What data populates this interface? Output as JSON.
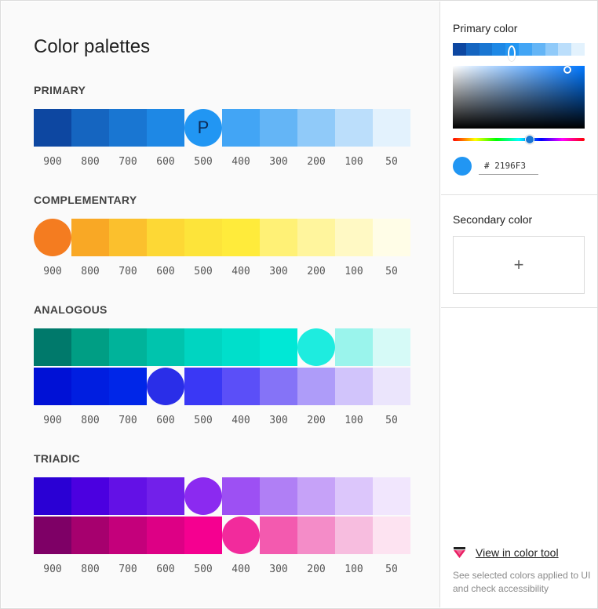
{
  "title": "Color palettes",
  "weights": [
    "900",
    "800",
    "700",
    "600",
    "500",
    "400",
    "300",
    "200",
    "100",
    "50"
  ],
  "sections": {
    "primary": {
      "label": "PRIMARY",
      "rows": [
        {
          "colors": [
            "#0d47a1",
            "#1565c0",
            "#1976d2",
            "#1e88e5",
            "#2196f3",
            "#42a5f5",
            "#64b5f6",
            "#90caf9",
            "#bbdefb",
            "#e3f2fd"
          ],
          "selected": 4,
          "mark": "P"
        }
      ]
    },
    "complementary": {
      "label": "COMPLEMENTARY",
      "rows": [
        {
          "colors": [
            "#f47c20",
            "#f9a825",
            "#fbc02d",
            "#fdd835",
            "#fde43a",
            "#ffeb3b",
            "#fff176",
            "#fff59d",
            "#fff9c4",
            "#fffde7"
          ],
          "selected": 0,
          "mark": ""
        }
      ]
    },
    "analogous": {
      "label": "ANALOGOUS",
      "rows": [
        {
          "colors": [
            "#00796b",
            "#009e84",
            "#00b39a",
            "#00c4ad",
            "#00d5c1",
            "#00dfcb",
            "#00e8d6",
            "#1eecdf",
            "#9af4ec",
            "#d6faf7"
          ],
          "selected": 7,
          "mark": ""
        },
        {
          "colors": [
            "#0011d6",
            "#001ee0",
            "#0026e8",
            "#2a2ee8",
            "#3a38f5",
            "#5b4ff8",
            "#8573f7",
            "#ae9cf9",
            "#d1c4fb",
            "#ebe5fc"
          ],
          "selected": 3,
          "mark": ""
        }
      ]
    },
    "triadic": {
      "label": "TRIADIC",
      "rows": [
        {
          "colors": [
            "#2a00d4",
            "#4b00e0",
            "#6311e6",
            "#7220ea",
            "#8b2af0",
            "#9d50f3",
            "#b07ff5",
            "#c6a2f8",
            "#dcc6fb",
            "#f1e6fd"
          ],
          "selected": 4,
          "mark": ""
        },
        {
          "colors": [
            "#7e0066",
            "#a6006e",
            "#c4007b",
            "#dd0085",
            "#f50090",
            "#f22b9c",
            "#f35aaf",
            "#f48cc8",
            "#f7bddf",
            "#fde3f1"
          ],
          "selected": 5,
          "mark": ""
        }
      ]
    }
  },
  "sidebar": {
    "primary_title": "Primary color",
    "hue_strip": [
      "#0d47a1",
      "#1565c0",
      "#1976d2",
      "#1e88e5",
      "#2196f3",
      "#42a5f5",
      "#64b5f6",
      "#90caf9",
      "#bbdefb",
      "#e3f2fd"
    ],
    "hue_strip_selected": 4,
    "hex_value": "# 2196F3",
    "primary_color": "#2196f3",
    "secondary_title": "Secondary color",
    "add_symbol": "+",
    "tool_link": "View in color tool",
    "tool_desc": "See selected colors applied to UI and check accessibility"
  }
}
